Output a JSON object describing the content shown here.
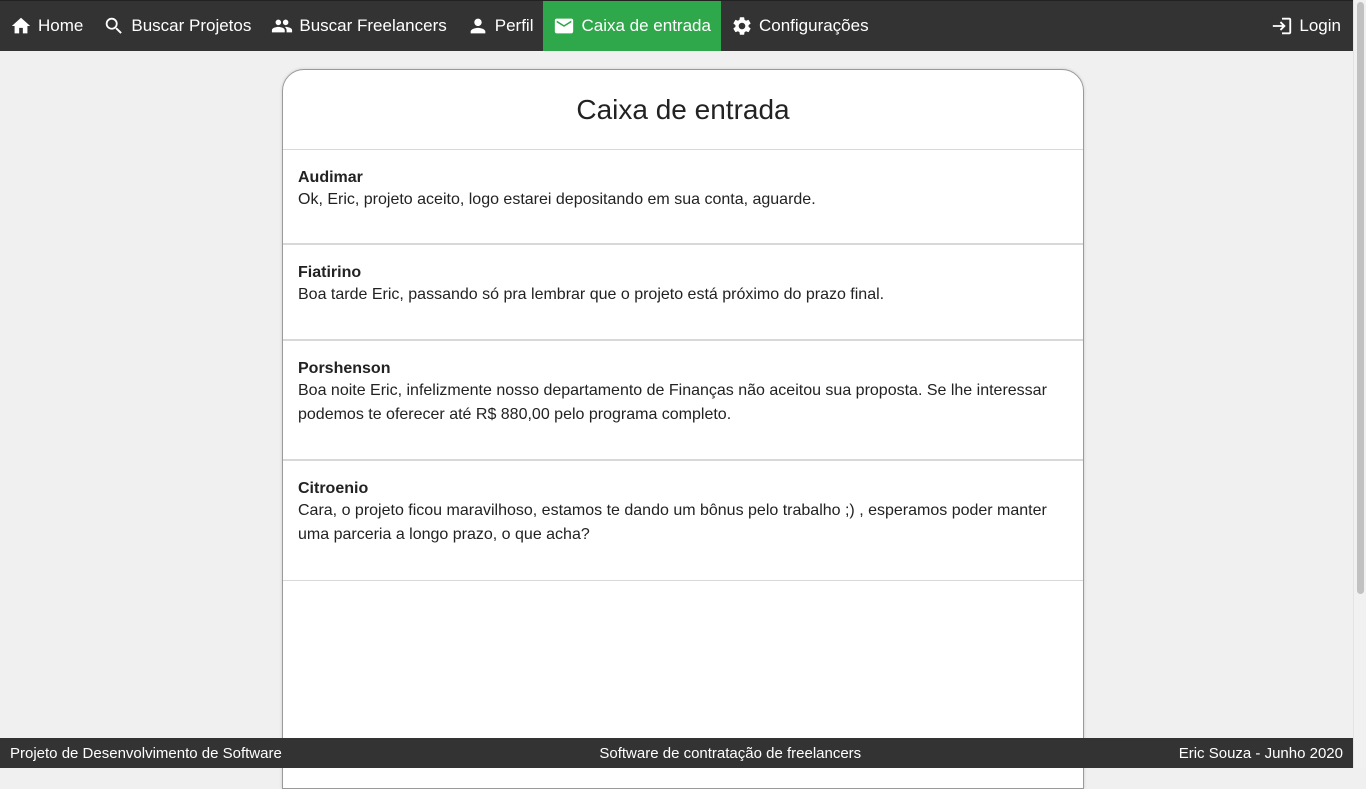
{
  "nav": {
    "items": [
      {
        "label": "Home",
        "icon": "home-icon"
      },
      {
        "label": "Buscar Projetos",
        "icon": "search-icon"
      },
      {
        "label": "Buscar Freelancers",
        "icon": "people-icon"
      },
      {
        "label": "Perfil",
        "icon": "person-icon"
      },
      {
        "label": "Caixa de entrada",
        "icon": "mail-icon",
        "active": true
      },
      {
        "label": "Configurações",
        "icon": "gear-icon"
      }
    ],
    "login": {
      "label": "Login",
      "icon": "login-icon"
    },
    "active_color": "#2ea84a",
    "bar_color": "#333333"
  },
  "inbox": {
    "title": "Caixa de entrada",
    "messages": [
      {
        "sender": "Audimar",
        "text": "Ok, Eric, projeto aceito, logo estarei depositando em sua conta, aguarde."
      },
      {
        "sender": "Fiatirino",
        "text": "Boa tarde Eric, passando só pra lembrar que o projeto está próximo do prazo final."
      },
      {
        "sender": "Porshenson",
        "text": "Boa noite Eric, infelizmente nosso departamento de Finanças não aceitou sua proposta. Se lhe interessar podemos te oferecer até R$ 880,00 pelo programa completo."
      },
      {
        "sender": "Citroenio",
        "text": "Cara, o projeto ficou maravilhoso, estamos te dando um bônus pelo trabalho ;) , esperamos poder manter uma parceria a longo prazo, o que acha?"
      }
    ]
  },
  "footer": {
    "left": "Projeto de Desenvolvimento de Software",
    "center": "Software de contratação de freelancers",
    "right": "Eric Souza - Junho 2020"
  }
}
